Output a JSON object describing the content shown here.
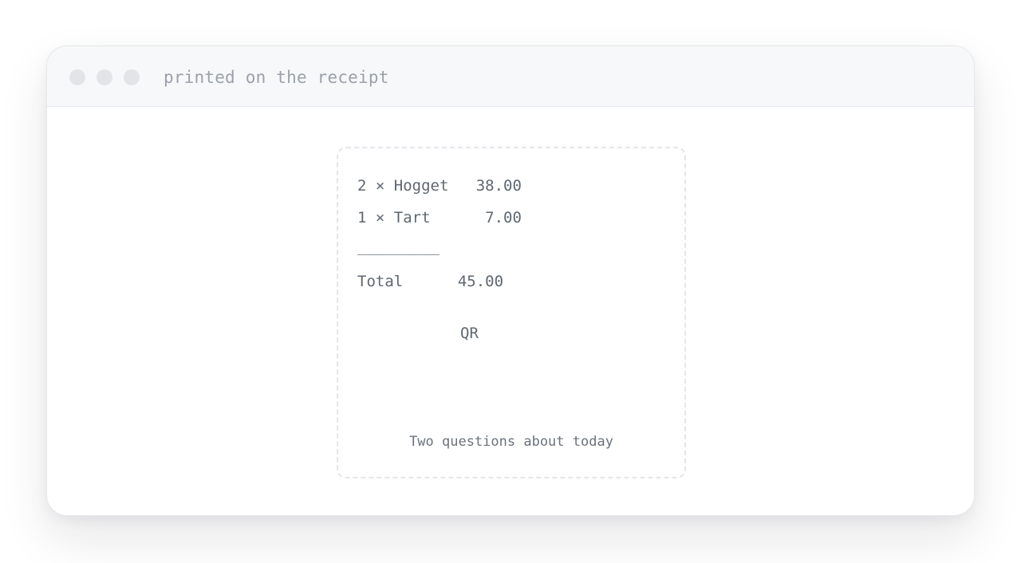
{
  "window": {
    "title": "printed on the receipt"
  },
  "receipt": {
    "lines": [
      "2 × Hogget   38.00",
      "1 × Tart      7.00",
      "_________",
      "Total      45.00"
    ],
    "qr_label": "QR",
    "footer": "Two questions about today"
  },
  "colors": {
    "window_border": "#e6e8eb",
    "titlebar_bg": "#f7f8f9",
    "traffic_dot": "#e2e4e7",
    "title_text": "#9aa1aa",
    "receipt_text": "#5f6771",
    "receipt_border": "#e3e6ea"
  }
}
